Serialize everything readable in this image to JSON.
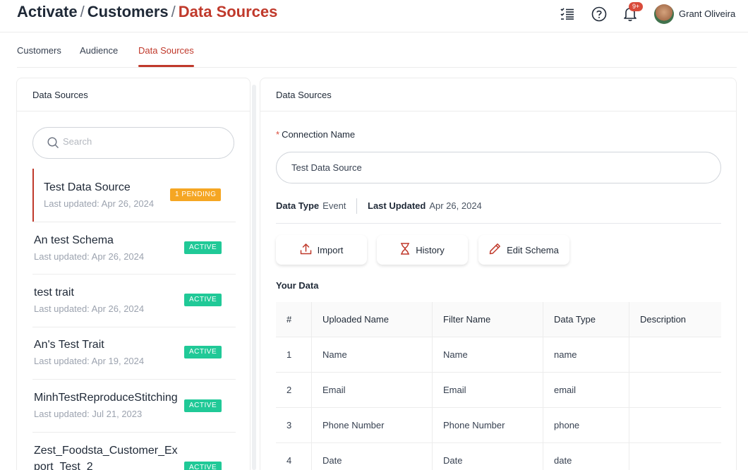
{
  "header": {
    "breadcrumb": [
      "Activate",
      "Customers",
      "Data Sources"
    ],
    "notification_badge": "9+",
    "user_name": "Grant Oliveira"
  },
  "tabs": [
    {
      "label": "Customers",
      "active": false
    },
    {
      "label": "Audience",
      "active": false
    },
    {
      "label": "Data Sources",
      "active": true
    }
  ],
  "left_panel": {
    "title": "Data Sources",
    "search_placeholder": "Search",
    "items": [
      {
        "name": "Test Data Source",
        "updated": "Last updated: Apr 26, 2024",
        "status": "1 PENDING",
        "selected": true
      },
      {
        "name": "An test Schema",
        "updated": "Last updated: Apr 26, 2024",
        "status": "ACTIVE"
      },
      {
        "name": "test trait",
        "updated": "Last updated: Apr 26, 2024",
        "status": "ACTIVE"
      },
      {
        "name": "An's Test Trait",
        "updated": "Last updated: Apr 19, 2024",
        "status": "ACTIVE"
      },
      {
        "name": "MinhTestReproduceStitching",
        "updated": "Last updated: Jul 21, 2023",
        "status": "ACTIVE"
      },
      {
        "name_line1": "Zest_Foodsta_Customer_Ex",
        "name_line2": "port_Test_2",
        "status": "ACTIVE"
      }
    ]
  },
  "right_panel": {
    "title": "Data Sources",
    "connection_label": "Connection Name",
    "required_mark": "*",
    "connection_value": "Test Data Source",
    "data_type_label": "Data Type",
    "data_type_value": "Event",
    "last_updated_label": "Last Updated",
    "last_updated_value": "Apr 26, 2024",
    "buttons": {
      "import": "Import",
      "history": "History",
      "edit_schema": "Edit Schema"
    },
    "your_data_title": "Your Data",
    "table": {
      "headers": [
        "#",
        "Uploaded Name",
        "Filter Name",
        "Data Type",
        "Description"
      ],
      "rows": [
        [
          "1",
          "Name",
          "Name",
          "name",
          ""
        ],
        [
          "2",
          "Email",
          "Email",
          "email",
          ""
        ],
        [
          "3",
          "Phone Number",
          "Phone Number",
          "phone",
          ""
        ],
        [
          "4",
          "Date",
          "Date",
          "date",
          ""
        ]
      ]
    }
  },
  "colors": {
    "accent": "#c0392b",
    "pending": "#f5a623",
    "active": "#20c997",
    "badge": "#d94b3b"
  },
  "icons": [
    "list-icon",
    "help-icon",
    "bell-icon",
    "search-icon",
    "upload-icon",
    "hourglass-icon",
    "pencil-icon"
  ]
}
